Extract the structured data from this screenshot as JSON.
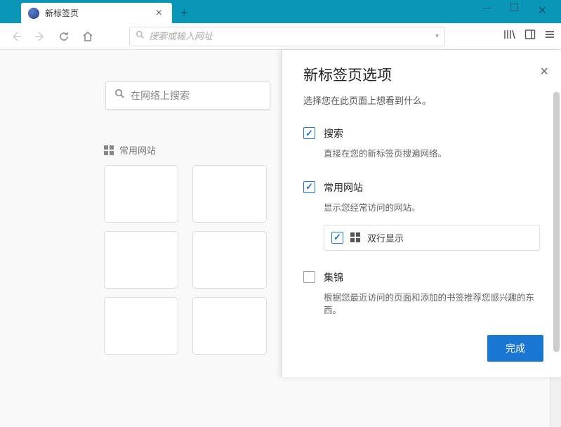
{
  "tab": {
    "title": "新标签页"
  },
  "urlbar": {
    "placeholder": "搜索或输入网址"
  },
  "newtab": {
    "search_placeholder": "在网络上搜索",
    "topsites_label": "常用网站"
  },
  "panel": {
    "title": "新标签页选项",
    "subtitle": "选择您在此页面上想看到什么。",
    "options": {
      "search": {
        "title": "搜索",
        "desc": "直接在您的新标签页搜遍网络。",
        "checked": true
      },
      "topsites": {
        "title": "常用网站",
        "desc": "显示您经常访问的网站。",
        "checked": true,
        "sub": {
          "label": "双行显示",
          "checked": true
        }
      },
      "highlights": {
        "title": "集锦",
        "desc": "根据您最近访问的页面和添加的书签推荐您感兴趣的东西。",
        "checked": false
      }
    },
    "done_label": "完成"
  }
}
